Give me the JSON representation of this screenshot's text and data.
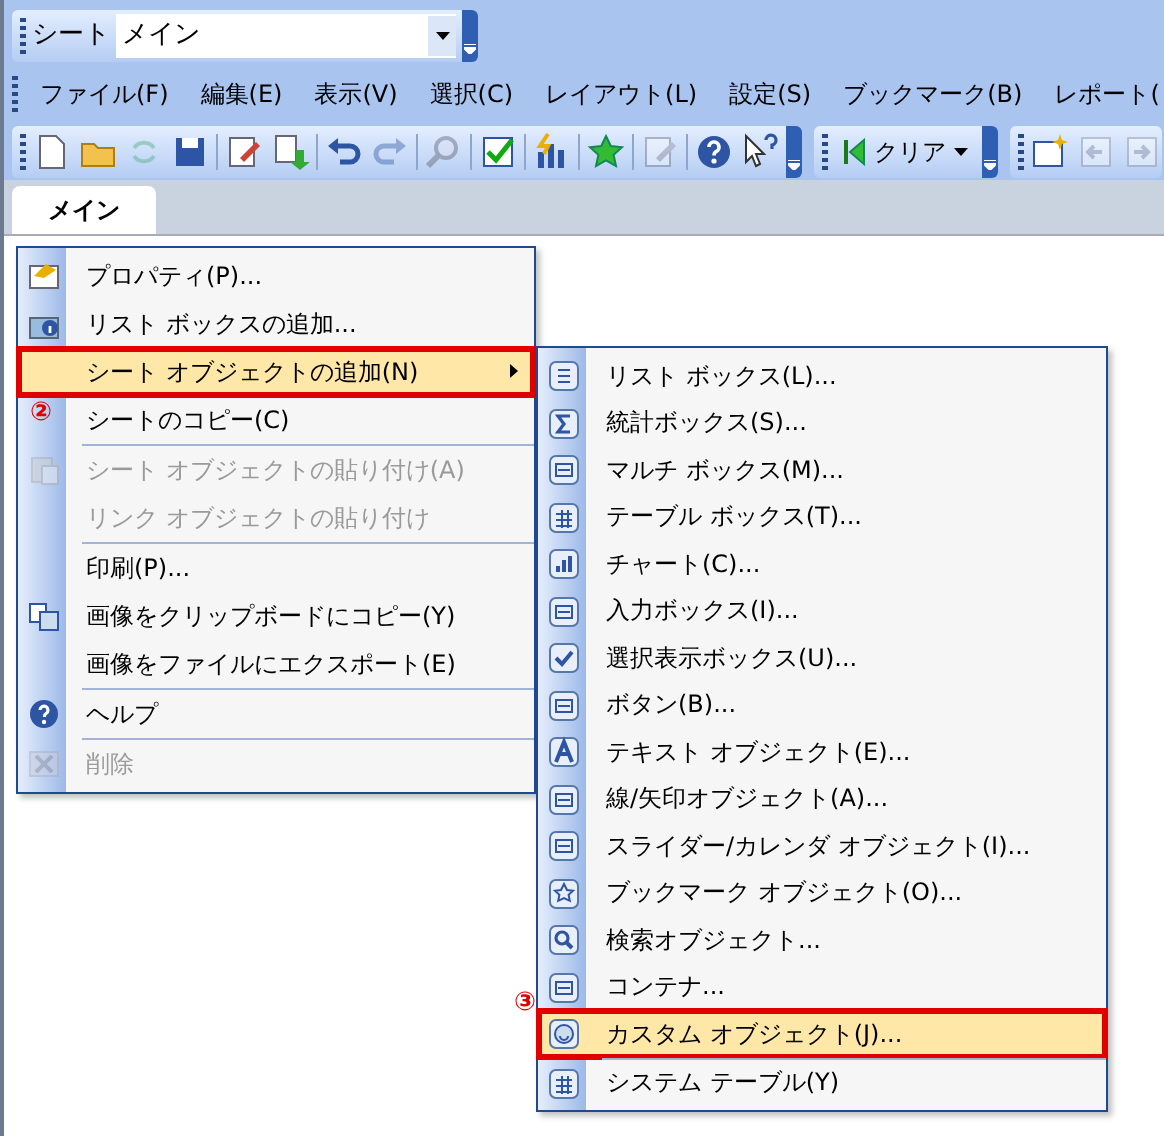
{
  "sheet_selector": {
    "label": "シート",
    "value": "メイン"
  },
  "menubar": [
    "ファイル(F)",
    "編集(E)",
    "表示(V)",
    "選択(C)",
    "レイアウト(L)",
    "設定(S)",
    "ブックマーク(B)",
    "レポート("
  ],
  "toolbar": {
    "buttons": [
      {
        "disabled": false
      },
      {
        "disabled": false
      },
      {
        "disabled": true
      },
      {
        "disabled": false
      },
      {
        "disabled": false
      },
      {
        "disabled": false
      },
      {
        "disabled": false
      },
      {
        "disabled": true
      },
      {
        "disabled": true
      },
      {
        "disabled": false
      },
      {
        "disabled": false
      },
      {
        "disabled": false
      },
      {
        "disabled": true
      },
      {
        "disabled": false
      },
      {
        "disabled": false
      }
    ],
    "clear_button": {
      "label": "クリア"
    },
    "extra_buttons": [
      {
        "disabled": false
      },
      {
        "disabled": true
      },
      {
        "disabled": true
      }
    ]
  },
  "tabs": [
    {
      "label": "メイン",
      "selected": true
    }
  ],
  "context_menu": [
    {
      "label": "プロパティ(P)...",
      "disabled": false,
      "selected": false
    },
    {
      "label": "リスト ボックスの追加...",
      "disabled": false,
      "selected": false
    },
    {
      "label": "シート オブジェクトの追加(N)",
      "disabled": false,
      "selected": true,
      "submenu": true,
      "callout": "②"
    },
    {
      "label": "シートのコピー(C)",
      "disabled": false,
      "selected": false
    },
    {
      "label": "シート オブジェクトの貼り付け(A)",
      "disabled": true,
      "selected": false,
      "separator_before": true
    },
    {
      "label": "リンク オブジェクトの貼り付け",
      "disabled": true,
      "selected": false
    },
    {
      "label": "印刷(P)...",
      "disabled": false,
      "selected": false,
      "separator_before": true
    },
    {
      "label": "画像をクリップボードにコピー(Y)",
      "disabled": false,
      "selected": false
    },
    {
      "label": "画像をファイルにエクスポート(E)",
      "disabled": false,
      "selected": false
    },
    {
      "label": "ヘルプ",
      "disabled": false,
      "selected": false,
      "separator_before": true
    },
    {
      "label": "削除",
      "disabled": true,
      "selected": false,
      "separator_before": true
    }
  ],
  "submenu": [
    {
      "label": "リスト ボックス(L)...",
      "selected": false
    },
    {
      "label": "統計ボックス(S)...",
      "selected": false
    },
    {
      "label": "マルチ ボックス(M)...",
      "selected": false
    },
    {
      "label": "テーブル ボックス(T)...",
      "selected": false
    },
    {
      "label": "チャート(C)...",
      "selected": false
    },
    {
      "label": "入力ボックス(I)...",
      "selected": false
    },
    {
      "label": "選択表示ボックス(U)...",
      "selected": false
    },
    {
      "label": "ボタン(B)...",
      "selected": false
    },
    {
      "label": "テキスト オブジェクト(E)...",
      "selected": false
    },
    {
      "label": "線/矢印オブジェクト(A)...",
      "selected": false
    },
    {
      "label": "スライダー/カレンダ オブジェクト(I)...",
      "selected": false
    },
    {
      "label": "ブックマーク オブジェクト(O)...",
      "selected": false
    },
    {
      "label": "検索オブジェクト...",
      "selected": false
    },
    {
      "label": "コンテナ...",
      "selected": false
    },
    {
      "label": "カスタム オブジェクト(J)...",
      "selected": true,
      "callout": "③"
    },
    {
      "label": "システム テーブル(Y)",
      "selected": false,
      "separator_before": true
    }
  ]
}
